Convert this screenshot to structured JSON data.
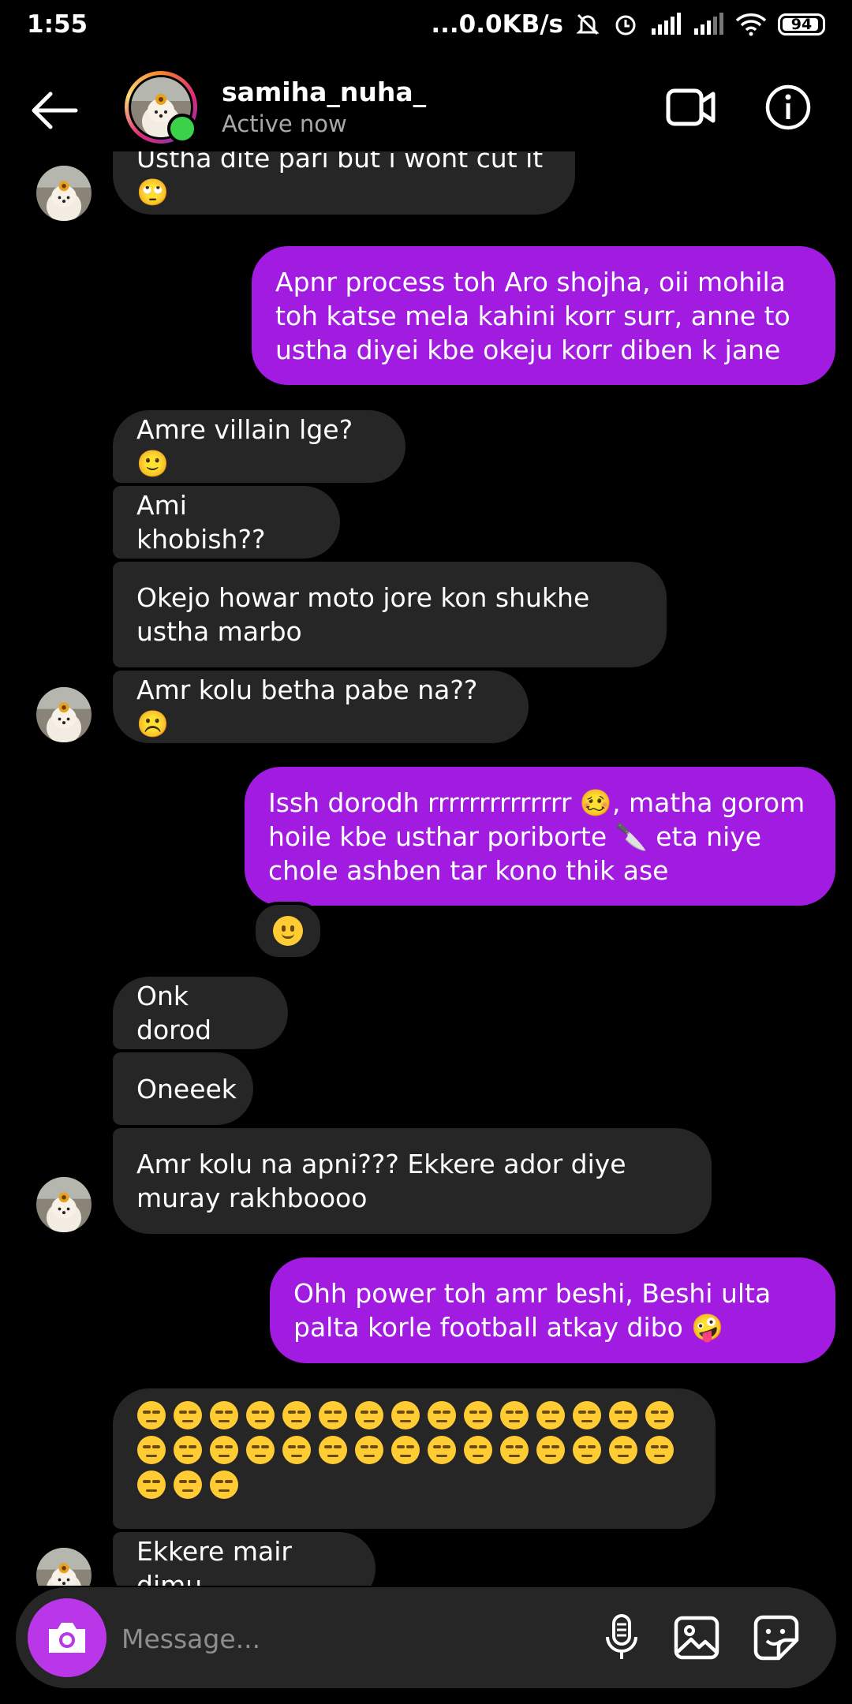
{
  "status_bar": {
    "time": "1:55",
    "network_speed": "...0.0KB/s",
    "battery": "94",
    "icons": [
      "mute-icon",
      "alarm-icon",
      "signal-icon",
      "signal-icon",
      "wifi-icon",
      "battery-icon"
    ]
  },
  "header": {
    "contact_name": "samiha_nuha_",
    "status": "Active now",
    "online": true
  },
  "messages": [
    {
      "side": "in",
      "text": "Ustha dite pari but i wont cut it 🙄"
    },
    {
      "side": "out",
      "text": "Apnr process toh Aro shojha, oii mohila toh katse mela kahini korr surr, anne to ustha diyei kbe okeju korr diben k jane"
    },
    {
      "side": "in",
      "text": "Amre villain lge? 🙂"
    },
    {
      "side": "in",
      "text": "Ami khobish??"
    },
    {
      "side": "in",
      "text": "Okejo howar moto jore kon shukhe ustha marbo"
    },
    {
      "side": "in",
      "text": "Amr kolu betha pabe na??  ☹️"
    },
    {
      "side": "out",
      "text": "Issh dorodh rrrrrrrrrrrrrr 🥴, matha gorom hoile kbe usthar poriborte 🔪 eta niye chole ashben tar kono thik ase",
      "reaction": "🙂"
    },
    {
      "side": "in",
      "text": "Onk dorod"
    },
    {
      "side": "in",
      "text": "Oneeek"
    },
    {
      "side": "in",
      "text": "Amr kolu na apni??? Ekkere ador diye muray rakhboooo"
    },
    {
      "side": "out",
      "text": "Ohh power toh amr beshi, Beshi ulta palta korle football atkay dibo 🤪"
    },
    {
      "side": "in",
      "text": "😒😒😒😒😒😒😒😒😒😒😒😒😒😒😒😒😒😒😒😒😒😒😒😒😒😒😒😒😒😒😒😒😒",
      "emoji_count": 33
    },
    {
      "side": "in",
      "text": "Ekkere mair dimu"
    }
  ],
  "composer": {
    "placeholder": "Message..."
  },
  "colors": {
    "background": "#000000",
    "incoming_bubble": "#262626",
    "outgoing_bubble": "#a21be0",
    "camera_button": "#b937e8",
    "online_dot": "#3cd14a",
    "secondary_text": "#a8a8a8"
  }
}
